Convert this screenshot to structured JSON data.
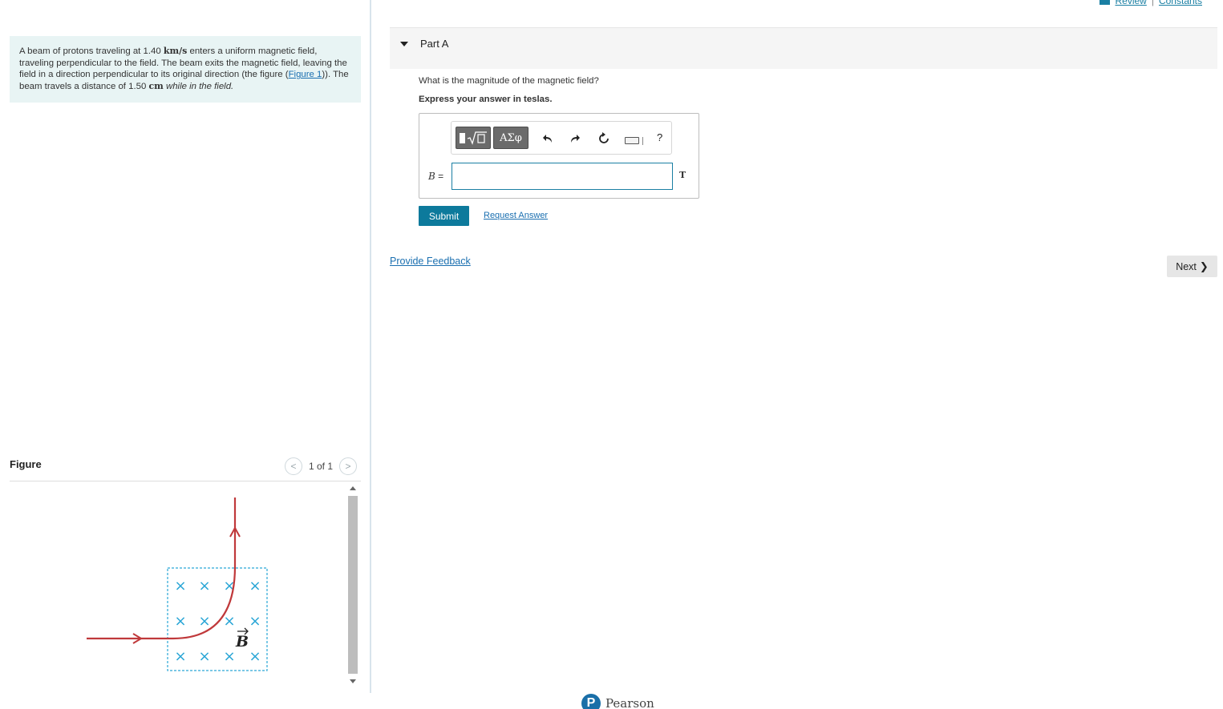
{
  "top_links": {
    "review": "Review",
    "separator": "|",
    "constants": "Constants"
  },
  "problem": {
    "text1": "A beam of protons traveling at 1.40 ",
    "unit1": "km/s",
    "text2": " enters a uniform magnetic field, traveling perpendicular to the field. The beam exits the magnetic field, leaving the field in a direction perpendicular to its original direction (the figure (",
    "figure_link": "Figure 1",
    "text3": ")). The beam travels a distance of 1.50 ",
    "unit2": "cm",
    "text4": " while in the field."
  },
  "figure": {
    "title": "Figure",
    "counter": "1 of 1",
    "prev_icon": "chevron-left-icon",
    "next_icon": "chevron-right-icon",
    "field_symbol": "B",
    "field_marker": "×"
  },
  "part": {
    "label": "Part A",
    "question": "What is the magnitude of the magnetic field?",
    "express": "Express your answer in teslas."
  },
  "toolbar": {
    "templates_icon": "templates-icon",
    "greek": "ΑΣφ",
    "undo_icon": "undo-icon",
    "redo_icon": "redo-icon",
    "reset_icon": "reset-icon",
    "keyboard_icon": "keyboard-icon",
    "help": "?"
  },
  "answer": {
    "variable": "B",
    "equals": " =",
    "value": "",
    "unit": "T"
  },
  "buttons": {
    "submit": "Submit",
    "request_answer": "Request Answer",
    "provide_feedback": "Provide Feedback",
    "next": "Next"
  },
  "footer": {
    "brand": "Pearson",
    "logo_letter": "P"
  },
  "colors": {
    "accent": "#0d7a9c",
    "link": "#1a6fb0",
    "problem_bg": "#e8f4f4",
    "trajectory": "#c0393b",
    "field_marker": "#2aa6d6"
  }
}
